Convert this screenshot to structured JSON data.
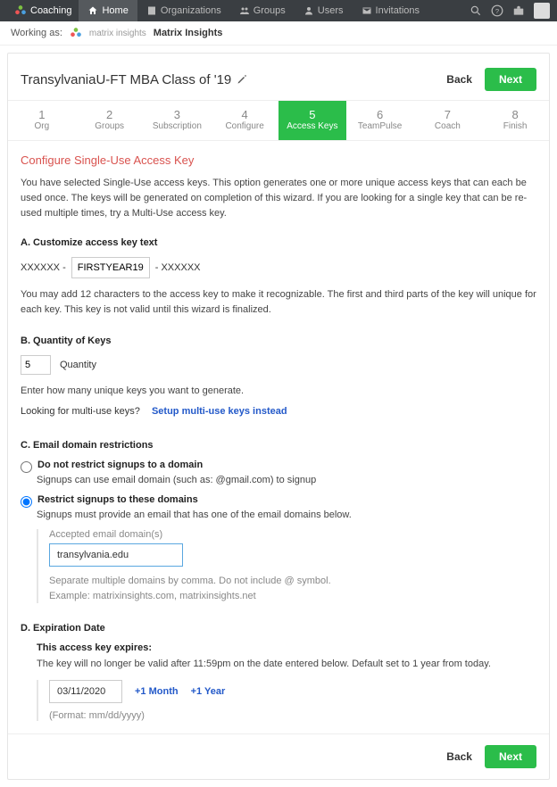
{
  "topnav": {
    "brand": "Coaching",
    "items": [
      {
        "label": "Home",
        "active": true
      },
      {
        "label": "Organizations",
        "active": false
      },
      {
        "label": "Groups",
        "active": false
      },
      {
        "label": "Users",
        "active": false
      },
      {
        "label": "Invitations",
        "active": false
      }
    ]
  },
  "workbar": {
    "label": "Working as:",
    "brand_small": "matrix insights",
    "org_name": "Matrix Insights"
  },
  "card": {
    "title": "TransylvaniaU-FT MBA Class of '19",
    "back": "Back",
    "next": "Next"
  },
  "steps": [
    {
      "num": "1",
      "label": "Org"
    },
    {
      "num": "2",
      "label": "Groups"
    },
    {
      "num": "3",
      "label": "Subscription"
    },
    {
      "num": "4",
      "label": "Configure"
    },
    {
      "num": "5",
      "label": "Access Keys"
    },
    {
      "num": "6",
      "label": "TeamPulse"
    },
    {
      "num": "7",
      "label": "Coach"
    },
    {
      "num": "8",
      "label": "Finish"
    }
  ],
  "active_step_index": 4,
  "configure": {
    "title": "Configure Single-Use Access Key",
    "desc": "You have selected Single-Use access keys. This option generates one or more unique access keys that can each be used once. The keys will be generated on completion of this wizard. If you are looking for a single key that can be re-used multiple times, try a Multi-Use access key.",
    "sectionA": {
      "head": "A. Customize access key text",
      "prefix": "XXXXXX -",
      "value": "FIRSTYEAR19",
      "suffix": "- XXXXXX",
      "note": "You may add 12 characters to the access key to make it recognizable. The first and third parts of the key will unique for each key. This key is not valid until this wizard is finalized."
    },
    "sectionB": {
      "head": "B. Quantity of Keys",
      "value": "5",
      "label": "Quantity",
      "note": "Enter how many unique keys you want to generate.",
      "multi_prompt": "Looking for multi-use keys?",
      "multi_link": "Setup multi-use keys instead"
    },
    "sectionC": {
      "head": "C. Email domain restrictions",
      "opt1_label": "Do not restrict signups to a domain",
      "opt1_sub": "Signups can use email domain (such as: @gmail.com) to signup",
      "opt2_label": "Restrict signups to these domains",
      "opt2_sub": "Signups must provide an email that has one of the email domains below.",
      "field_label": "Accepted email domain(s)",
      "field_value": "transylvania.edu",
      "hint1": "Separate multiple domains by comma. Do not include @ symbol.",
      "hint2": "Example: matrixinsights.com, matrixinsights.net"
    },
    "sectionD": {
      "head": "D. Expiration Date",
      "sub": "This access key expires:",
      "note": "The key will no longer be valid after 11:59pm on the date entered below. Default set to 1 year from today.",
      "value": "03/11/2020",
      "plus_month": "+1 Month",
      "plus_year": "+1 Year",
      "format": "(Format: mm/dd/yyyy)"
    }
  },
  "footer": {
    "back": "Back",
    "next": "Next"
  }
}
